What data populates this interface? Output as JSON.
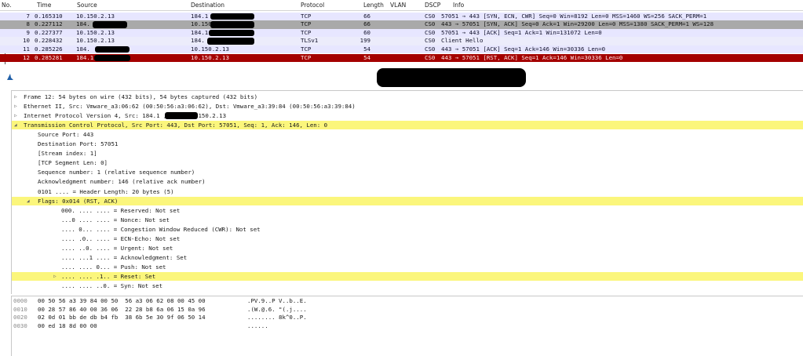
{
  "packet_list": {
    "columns": [
      "No.",
      "Time",
      "Source",
      "Destination",
      "Protocol",
      "Length",
      "VLAN",
      "DSCP",
      "Info"
    ],
    "rows": [
      {
        "no": "7",
        "time": "0.165310",
        "source": "10.150.2.13",
        "destination": "184.1",
        "protocol": "TCP",
        "length": "66",
        "dscp": "CS0",
        "info": "57051 → 443 [SYN, ECN, CWR] Seq=0 Win=8192 Len=0 MSS=1460 WS=256 SACK_PERM=1",
        "style": "tcp"
      },
      {
        "no": "8",
        "time": "0.227112",
        "source": "184.",
        "destination": "10.150.2.13",
        "protocol": "TCP",
        "length": "66",
        "dscp": "CS0",
        "info": "443 → 57051 [SYN, ACK] Seq=0 Ack=1 Win=29200 Len=0 MSS=1380 SACK_PERM=1 WS=128",
        "style": "sel"
      },
      {
        "no": "9",
        "time": "0.227377",
        "source": "10.150.2.13",
        "destination": "184.1",
        "protocol": "TCP",
        "length": "60",
        "dscp": "CS0",
        "info": "57051 → 443 [ACK] Seq=1 Ack=1 Win=131072 Len=0",
        "style": "tcp"
      },
      {
        "no": "10",
        "time": "0.228432",
        "source": "10.150.2.13",
        "destination": "184.",
        "protocol": "TLSv1",
        "length": "199",
        "dscp": "CS0",
        "info": "Client Hello",
        "style": "tls"
      },
      {
        "no": "11",
        "time": "0.285226",
        "source": "184.",
        "destination": "10.150.2.13",
        "protocol": "TCP",
        "length": "54",
        "dscp": "CS0",
        "info": "443 → 57051 [ACK] Seq=1 Ack=146 Win=30336 Len=0",
        "style": "tcp"
      },
      {
        "no": "12",
        "time": "0.285281",
        "source": "184.1",
        "destination": "10.150.2.13",
        "protocol": "TCP",
        "length": "54",
        "dscp": "CS0",
        "info": "443 → 57051 [RST, ACK] Seq=1 Ack=146 Win=30336 Len=0",
        "style": "rst"
      }
    ]
  },
  "details": [
    {
      "text": "Frame 12: 54 bytes on wire (432 bits), 54 bytes captured (432 bits)",
      "indent": 0,
      "twisty": "closed",
      "hl": false
    },
    {
      "text": "Ethernet II, Src: Vmware_a3:06:62 (00:50:56:a3:06:62), Dst: Vmware_a3:39:84 (00:50:56:a3:39:84)",
      "indent": 0,
      "twisty": "closed",
      "hl": false
    },
    {
      "text": "Internet Protocol Version 4, Src: 184.1          , Dst: 10.150.2.13",
      "indent": 0,
      "twisty": "closed",
      "hl": false
    },
    {
      "text": "Transmission Control Protocol, Src Port: 443, Dst Port: 57051, Seq: 1, Ack: 146, Len: 0",
      "indent": 0,
      "twisty": "open",
      "hl": true
    },
    {
      "text": "Source Port: 443",
      "indent": 1,
      "twisty": "",
      "hl": false
    },
    {
      "text": "Destination Port: 57051",
      "indent": 1,
      "twisty": "",
      "hl": false
    },
    {
      "text": "[Stream index: 1]",
      "indent": 1,
      "twisty": "",
      "hl": false
    },
    {
      "text": "[TCP Segment Len: 0]",
      "indent": 1,
      "twisty": "",
      "hl": false
    },
    {
      "text": "Sequence number: 1    (relative sequence number)",
      "indent": 1,
      "twisty": "",
      "hl": false
    },
    {
      "text": "Acknowledgment number: 146    (relative ack number)",
      "indent": 1,
      "twisty": "",
      "hl": false
    },
    {
      "text": "0101 .... = Header Length: 20 bytes (5)",
      "indent": 1,
      "twisty": "",
      "hl": false
    },
    {
      "text": "Flags: 0x014 (RST, ACK)",
      "indent": 1,
      "twisty": "open",
      "hl": true
    },
    {
      "text": "000. .... .... = Reserved: Not set",
      "indent": 2,
      "twisty": "",
      "hl": false
    },
    {
      "text": "...0 .... .... = Nonce: Not set",
      "indent": 2,
      "twisty": "",
      "hl": false
    },
    {
      "text": ".... 0... .... = Congestion Window Reduced (CWR): Not set",
      "indent": 2,
      "twisty": "",
      "hl": false
    },
    {
      "text": ".... .0.. .... = ECN-Echo: Not set",
      "indent": 2,
      "twisty": "",
      "hl": false
    },
    {
      "text": ".... ..0. .... = Urgent: Not set",
      "indent": 2,
      "twisty": "",
      "hl": false
    },
    {
      "text": ".... ...1 .... = Acknowledgment: Set",
      "indent": 2,
      "twisty": "",
      "hl": false
    },
    {
      "text": ".... .... 0... = Push: Not set",
      "indent": 2,
      "twisty": "",
      "hl": false
    },
    {
      "text": ".... .... .1.. = Reset: Set",
      "indent": 2,
      "twisty": "closed",
      "hl": true
    },
    {
      "text": ".... .... ..0. = Syn: Not set",
      "indent": 2,
      "twisty": "",
      "hl": false
    }
  ],
  "bytes": [
    {
      "offset": "0000",
      "hex": "00 50 56 a3 39 84 00 50  56 a3 06 62 08 00 45 00",
      "ascii": ".PV.9..P V..b..E."
    },
    {
      "offset": "0010",
      "hex": "00 28 57 86 40 00 36 06  22 28 b8 6a 06 15 0a 96",
      "ascii": ".(W.@.6. \"(.j...."
    },
    {
      "offset": "0020",
      "hex": "02 0d 01 bb de db b4 fb  38 6b 5e 30 9f 06 50 14",
      "ascii": "........ 8k^0..P."
    },
    {
      "offset": "0030",
      "hex": "00 ed 18 8d 00 00",
      "ascii": "......"
    }
  ],
  "icons": {
    "shark_fin": "shark-fin-icon"
  },
  "colors": {
    "tcp_row": "#e7e6ff",
    "selected_row": "#a9a9a9",
    "rst_row": "#a40000",
    "highlight": "#fbf67c"
  }
}
